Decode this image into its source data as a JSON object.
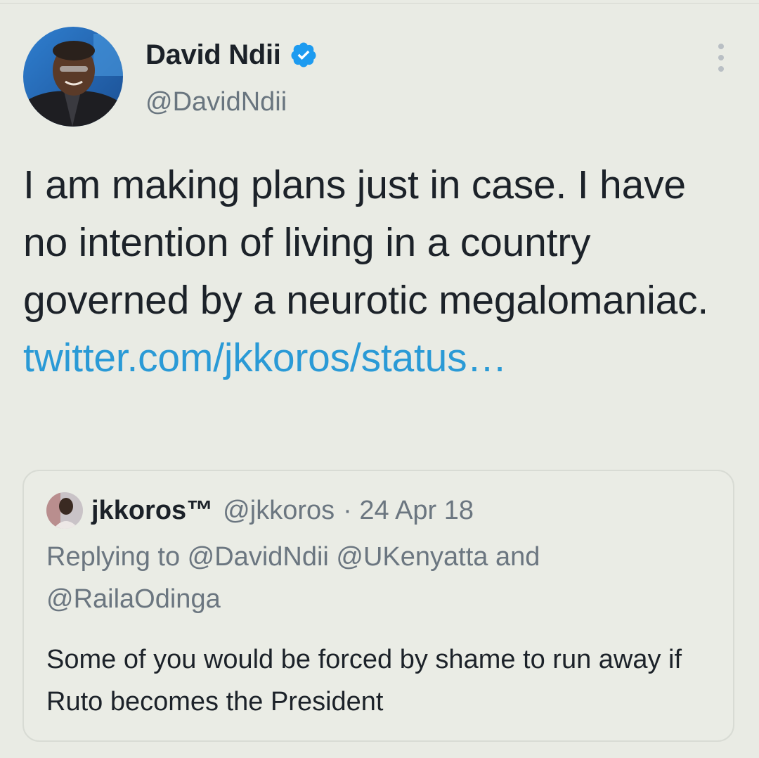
{
  "author": {
    "display_name": "David Ndii",
    "handle": "@DavidNdii",
    "verified_icon": "verified-badge-icon"
  },
  "tweet": {
    "text": "I am making plans just in case. I have no intention of living in a country governed by a neurotic megalomaniac.",
    "link": "twitter.com/jkkoros/status…"
  },
  "quoted_tweet": {
    "display_name": "jkkoros™",
    "handle": "@jkkoros",
    "date": "· 24 Apr 18",
    "replying_to": "Replying to @DavidNdii @UKenyatta and @RailaOdinga",
    "text": "Some of you would be forced by shame to run away if Ruto becomes the President"
  },
  "icons": {
    "more": "more-vertical-icon"
  },
  "colors": {
    "background": "#e9ebe4",
    "link": "#2a9ad6",
    "verified": "#1d9bf0",
    "secondary_text": "#6b7680"
  }
}
